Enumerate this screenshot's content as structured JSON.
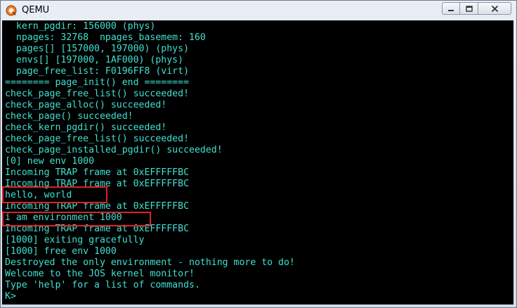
{
  "window": {
    "title": "QEMU",
    "icon": "qemu-app-icon"
  },
  "controls": {
    "minimize_icon": "minimize-icon",
    "maximize_icon": "maximize-icon",
    "close_icon": "close-icon"
  },
  "terminal": {
    "text_color": "#40e0d0",
    "background": "#000000",
    "lines": [
      "  kern_pgdir: 156000 (phys)",
      "  npages: 32768  npages_basemem: 160",
      "  pages[] [157000, 197000) (phys)",
      "  envs[] [197000, 1AF000) (phys)",
      "  page_free_list: F0196FF8 (virt)",
      "======== page_init() end ========",
      "check_page_free_list() succeeded!",
      "check_page_alloc() succeeded!",
      "check_page() succeeded!",
      "check_kern_pgdir() succeeded!",
      "check_page_free_list() succeeded!",
      "check_page_installed_pgdir() succeeded!",
      "[0] new env 1000",
      "Incoming TRAP frame at 0xEFFFFFBC",
      "Incoming TRAP frame at 0xEFFFFFBC",
      "hello, world",
      "Incoming TRAP frame at 0xEFFFFFBC",
      "i am environment 1000",
      "Incoming TRAP frame at 0xEFFFFFBC",
      "[1000] exiting gracefully",
      "[1000] free env 1000",
      "Destroyed the only environment - nothing more to do!",
      "Welcome to the JOS kernel monitor!",
      "Type 'help' for a list of commands.",
      "K> "
    ]
  },
  "annotations": {
    "color": "#e01f25"
  }
}
